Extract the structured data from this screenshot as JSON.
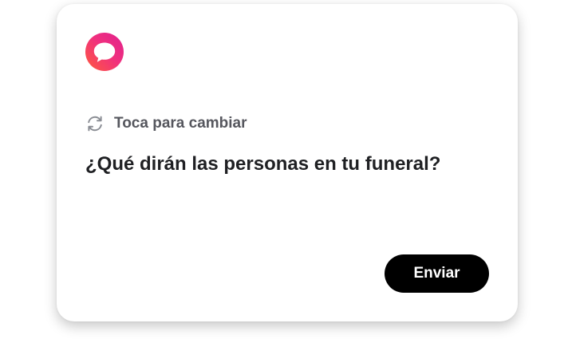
{
  "prompt_card": {
    "logo_icon": "speech-bubble-icon",
    "brand_gradient": [
      "#ff5a3c",
      "#e0208e"
    ],
    "change_hint": {
      "icon": "refresh-icon",
      "label": "Toca para cambiar"
    },
    "question": "¿Qué dirán las personas en tu funeral?",
    "send_label": "Enviar"
  }
}
